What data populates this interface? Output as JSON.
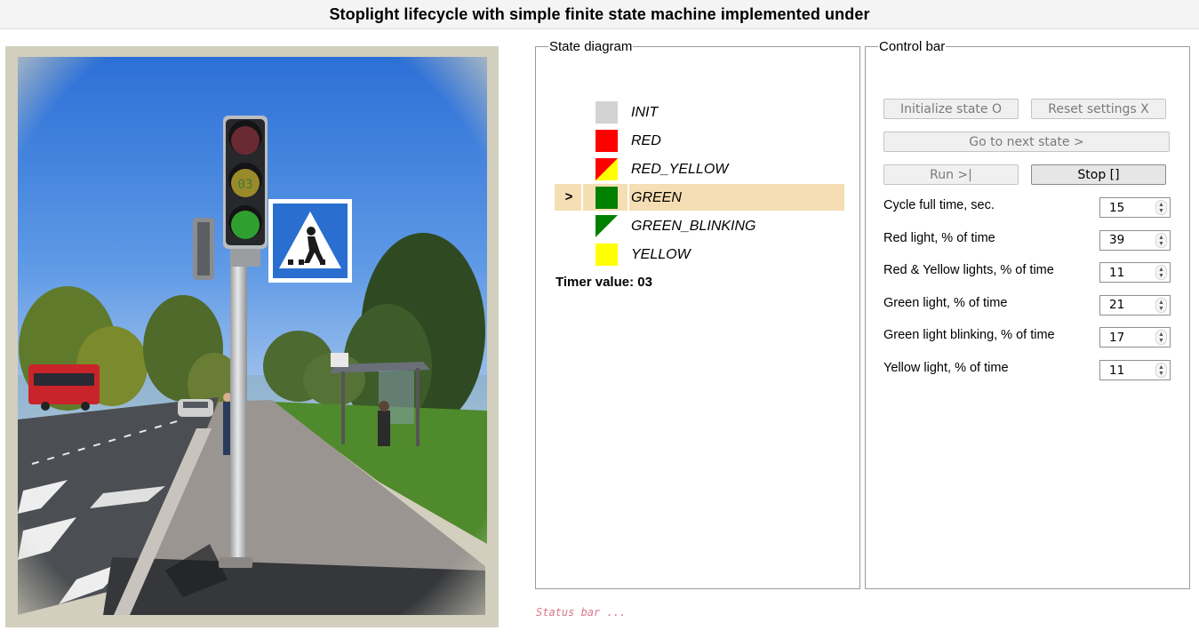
{
  "title": "Stoplight lifecycle with simple finite state machine implemented under",
  "photo": {
    "countdown": "03"
  },
  "state_diagram": {
    "legend": "State diagram",
    "pointer": ">",
    "states": [
      {
        "name": "INIT",
        "colors": [
          "#d3d3d3"
        ],
        "active": false
      },
      {
        "name": "RED",
        "colors": [
          "#ff0000"
        ],
        "active": false
      },
      {
        "name": "RED_YELLOW",
        "colors": [
          "#ff0000",
          "#ffff00"
        ],
        "active": false
      },
      {
        "name": "GREEN",
        "colors": [
          "#008000"
        ],
        "active": true
      },
      {
        "name": "GREEN_BLINKING",
        "colors": [
          "#008000",
          "#ffffff"
        ],
        "active": false
      },
      {
        "name": "YELLOW",
        "colors": [
          "#ffff00"
        ],
        "active": false
      }
    ],
    "timer_label": "Timer value: 03"
  },
  "control_bar": {
    "legend": "Control bar",
    "buttons": {
      "initialize": "Initialize state O",
      "reset": "Reset settings X",
      "next": "Go to next state >",
      "run": "Run >|",
      "stop": "Stop []"
    },
    "fields": [
      {
        "label": "Cycle full time, sec.",
        "value": "15"
      },
      {
        "label": "Red light, % of time",
        "value": "39"
      },
      {
        "label": "Red & Yellow lights, % of time",
        "value": "11"
      },
      {
        "label": "Green light, % of time",
        "value": "21"
      },
      {
        "label": "Green light blinking, % of time",
        "value": "17"
      },
      {
        "label": "Yellow light, % of time",
        "value": "11"
      }
    ]
  },
  "status_bar": "Status bar ..."
}
